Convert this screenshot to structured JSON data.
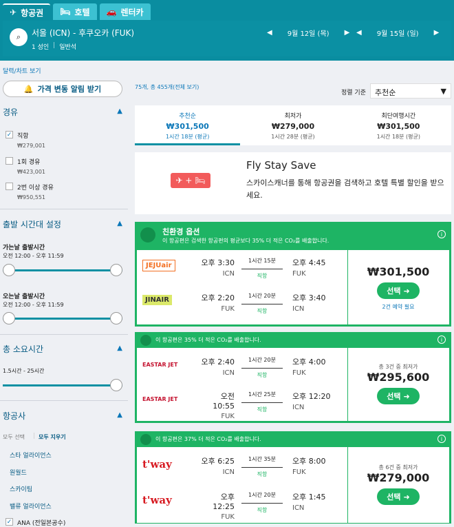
{
  "tabs": [
    {
      "label": "항공권"
    },
    {
      "label": "호텔"
    },
    {
      "label": "렌터카"
    }
  ],
  "search": {
    "route": "서울 (ICN) - 후쿠오카 (FUK)",
    "passengers": "1 성인",
    "cabin": "일반석",
    "depart_date": "9월 12일 (목)",
    "return_date": "9월 15일 (일)"
  },
  "left": {
    "calendar_link": "달력/차트 보기",
    "price_alert": "가격 변동 알림 받기",
    "stops": {
      "title": "경유",
      "options": [
        {
          "label": "직항",
          "price": "₩279,001",
          "checked": true
        },
        {
          "label": "1회 경유",
          "price": "₩423,001",
          "checked": false
        },
        {
          "label": "2번 이상 경유",
          "price": "₩950,551",
          "checked": false
        }
      ]
    },
    "times": {
      "title": "출발 시간대 설정",
      "outbound_label": "가는날 출발시간",
      "outbound_range": "오전 12:00 - 오후 11:59",
      "return_label": "오는날 출발시간",
      "return_range": "오전 12:00 - 오후 11:59"
    },
    "duration": {
      "title": "총 소요시간",
      "range": "1.5시간 - 25시간"
    },
    "airlines": {
      "title": "항공사",
      "select_all": "모두 선택",
      "clear_all": "모두 지우기",
      "items": [
        "스타 얼라이언스",
        "원월드",
        "스카이팀",
        "밸류 얼라이언스",
        "ANA (전일본공수)"
      ]
    }
  },
  "main": {
    "count": "75개, 총 455개(전체 보기)",
    "sort_label": "정렬 기준",
    "sort_value": "추천순",
    "sort_tabs": [
      {
        "label": "추천순",
        "price": "₩301,500",
        "time": "1시간 18분 (평균)"
      },
      {
        "label": "최저가",
        "price": "₩279,000",
        "time": "1시간 28분 (평균)"
      },
      {
        "label": "최단여행시간",
        "price": "₩301,500",
        "time": "1시간 18분 (평균)"
      }
    ],
    "promo": {
      "title": "Fly Stay Save",
      "text": "스카이스캐너를 통해 항공권을 검색하고 호텔 특별 할인을 받으세요."
    },
    "results": [
      {
        "eco_title": "친환경 옵션",
        "eco_text": "이 항공편은 검색한 항공편의 평균보다 35% 더 적은 CO₂를 배출합니다.",
        "legs": [
          {
            "airline": "JEJUair",
            "dep": "오후 3:30",
            "from": "ICN",
            "dur": "1시간 15분",
            "stop": "직항",
            "arr": "오후 4:45",
            "to": "FUK"
          },
          {
            "airline": "JINAIR",
            "dep": "오후 2:20",
            "from": "FUK",
            "dur": "1시간 20분",
            "stop": "직항",
            "arr": "오후 3:40",
            "to": "ICN"
          }
        ],
        "price": "₩301,500",
        "select": "선택",
        "note": "2건 예약 필요",
        "cheapest": ""
      },
      {
        "eco_title": "",
        "eco_text": "이 항공편은 35% 더 적은 CO₂를 배출합니다.",
        "legs": [
          {
            "airline": "EASTAR JET",
            "dep": "오후 2:40",
            "from": "ICN",
            "dur": "1시간 20분",
            "stop": "직항",
            "arr": "오후 4:00",
            "to": "FUK"
          },
          {
            "airline": "EASTAR JET",
            "dep": "오전 10:55",
            "from": "FUK",
            "dur": "1시간 25분",
            "stop": "직항",
            "arr": "오후 12:20",
            "to": "ICN"
          }
        ],
        "price": "₩295,600",
        "select": "선택",
        "note": "",
        "cheapest": "총 3건 중 최저가"
      },
      {
        "eco_title": "",
        "eco_text": "이 항공편은 37% 더 적은 CO₂를 배출합니다.",
        "legs": [
          {
            "airline": "t'way",
            "dep": "오후 6:25",
            "from": "ICN",
            "dur": "1시간 35분",
            "stop": "직항",
            "arr": "오후 8:00",
            "to": "FUK"
          },
          {
            "airline": "t'way",
            "dep": "오후 12:25",
            "from": "FUK",
            "dur": "1시간 20분",
            "stop": "직항",
            "arr": "오후 1:45",
            "to": "ICN"
          }
        ],
        "price": "₩279,000",
        "select": "선택",
        "note": "",
        "cheapest": "총 6건 중 최저가"
      }
    ]
  },
  "colors": {
    "teal": "#0b90a3",
    "green": "#1eb464",
    "blue": "#0b77b8"
  }
}
